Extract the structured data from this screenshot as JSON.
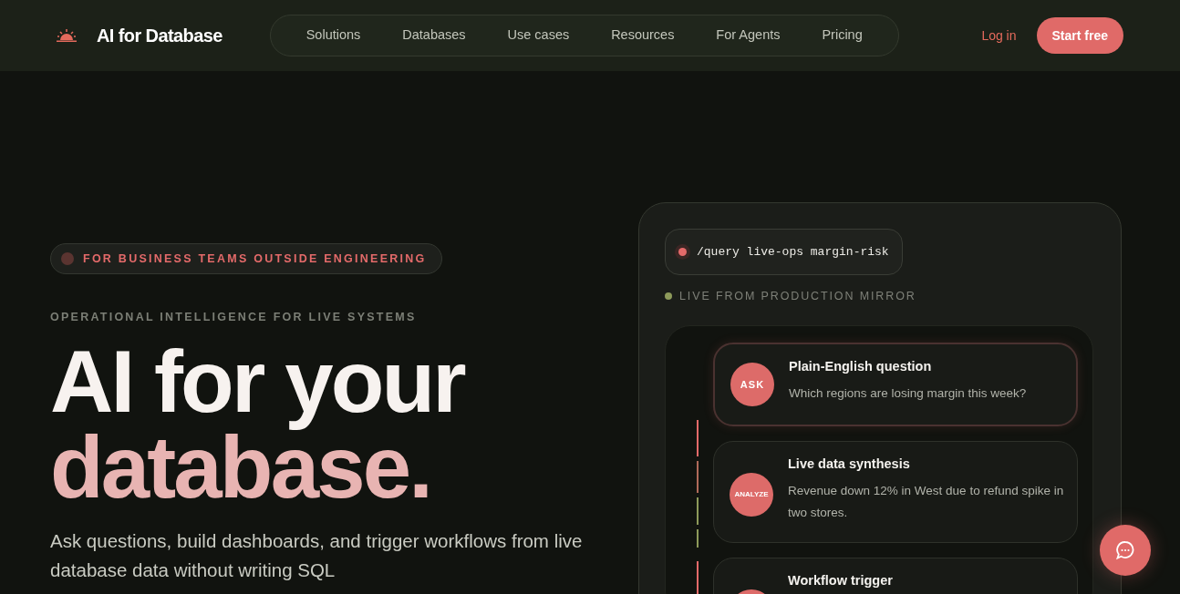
{
  "header": {
    "brand": "AI for Database",
    "nav": [
      {
        "label": "Solutions"
      },
      {
        "label": "Databases"
      },
      {
        "label": "Use cases"
      },
      {
        "label": "Resources"
      },
      {
        "label": "For Agents"
      },
      {
        "label": "Pricing"
      }
    ],
    "login": "Log in",
    "cta": "Start free"
  },
  "hero": {
    "badge": "FOR BUSINESS TEAMS OUTSIDE ENGINEERING",
    "eyebrow": "OPERATIONAL INTELLIGENCE FOR LIVE SYSTEMS",
    "headline_line_1": "AI for your",
    "headline_line_2": "database.",
    "description": "Ask questions, build dashboards, and trigger workflows from live database data without writing SQL"
  },
  "demo_panel": {
    "command": "/query live-ops margin-risk",
    "status": "LIVE FROM PRODUCTION MIRROR",
    "steps": [
      {
        "badge": "ASK",
        "title": "Plain-English question",
        "text": "Which regions are losing margin this week?",
        "active": true
      },
      {
        "badge": "ANALYZE",
        "title": "Live data synthesis",
        "text": "Revenue down 12% in West due to refund spike in two stores.",
        "active": false
      },
      {
        "title": "Workflow trigger",
        "active": false
      }
    ]
  }
}
